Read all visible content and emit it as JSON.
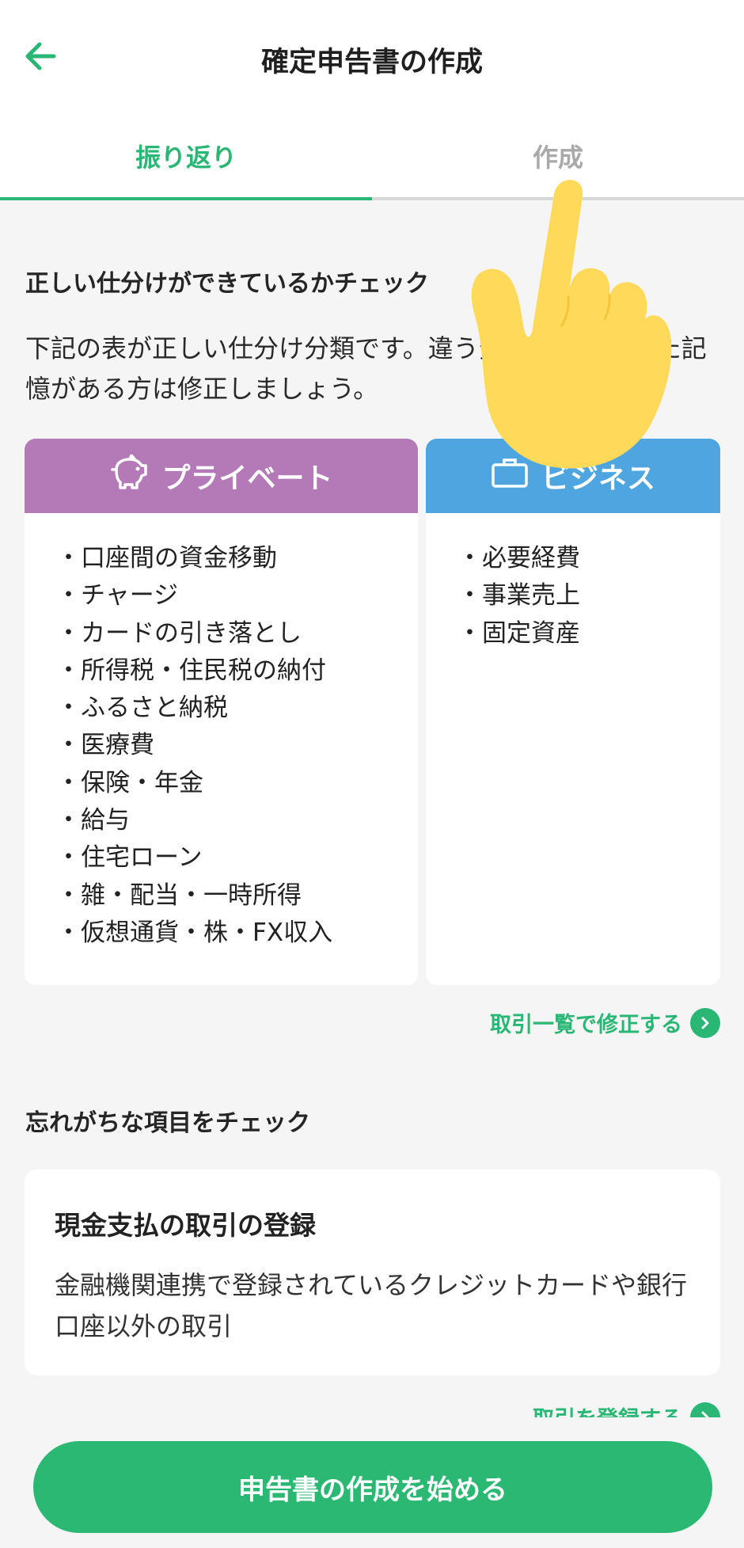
{
  "header": {
    "title": "確定申告書の作成"
  },
  "tabs": [
    {
      "label": "振り返り",
      "active": true
    },
    {
      "label": "作成",
      "active": false
    }
  ],
  "section1": {
    "heading": "正しい仕分けができているかチェック",
    "description": "下記の表が正しい仕分け分類です。違う分類で仕分けした記憶がある方は修正しましょう。"
  },
  "private_card": {
    "label": "プライベート",
    "icon": "piggy-bank-icon",
    "color": "#b47ab8",
    "items": [
      "口座間の資金移動",
      "チャージ",
      "カードの引き落とし",
      "所得税・住民税の納付",
      "ふるさと納税",
      "医療費",
      "保険・年金",
      "給与",
      "住宅ローン",
      "雑・配当・一時所得",
      "仮想通貨・株・FX収入"
    ]
  },
  "business_card": {
    "label": "ビジネス",
    "icon": "briefcase-icon",
    "color": "#4ea5e0",
    "items": [
      "必要経費",
      "事業売上",
      "固定資産"
    ]
  },
  "fix_link": {
    "label": "取引一覧で修正する"
  },
  "section2": {
    "heading": "忘れがちな項目をチェック"
  },
  "cash_card": {
    "title": "現金支払の取引の登録",
    "description": "金融機関連携で登録されているクレジットカードや銀行口座以外の取引"
  },
  "register_link": {
    "label": "取引を登録する"
  },
  "cta": {
    "label": "申告書の作成を始める"
  },
  "colors": {
    "accent": "#2ab674",
    "background": "#f5f5f5",
    "hand": "#ffd95a"
  }
}
